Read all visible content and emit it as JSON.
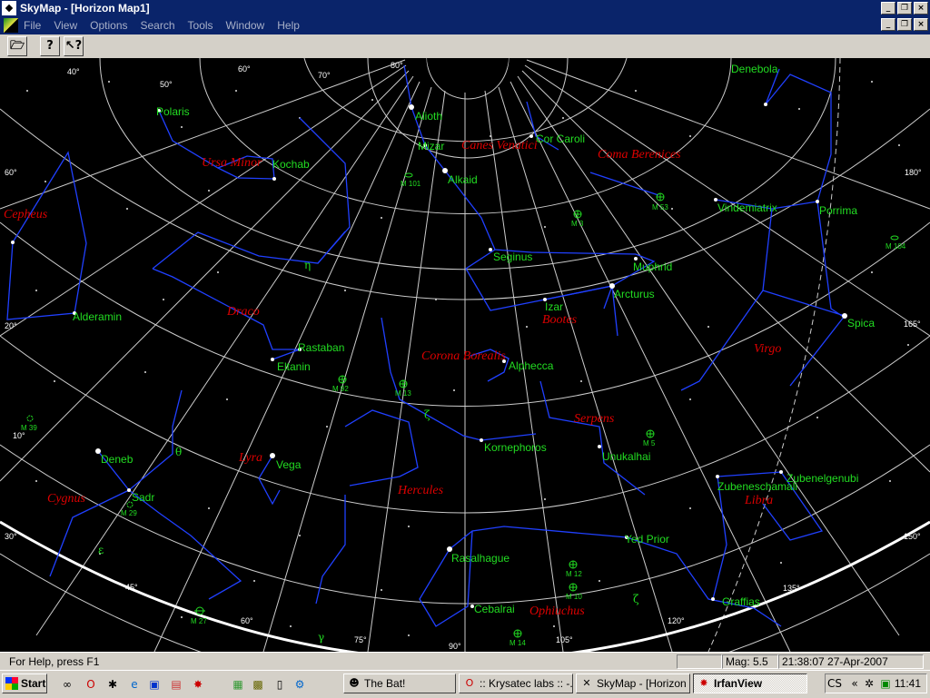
{
  "window": {
    "title": "SkyMap - [Horizon Map1]"
  },
  "menu": [
    "File",
    "View",
    "Options",
    "Search",
    "Tools",
    "Window",
    "Help"
  ],
  "toolbar": {
    "open_icon": "folder-open-icon",
    "help_icon": "help-icon",
    "context_help_icon": "context-help-icon"
  },
  "map": {
    "degree_labels": [
      "40°",
      "50°",
      "60°",
      "70°",
      "80°",
      "60°",
      "180°",
      "20°",
      "165°",
      "10°",
      "30°",
      "45°",
      "60°",
      "75°",
      "90°",
      "105°",
      "120°",
      "135°",
      "150°"
    ],
    "constellations": [
      "Cepheus",
      "Ursa Minor",
      "Draco",
      "Canes Venatici",
      "Coma Berenices",
      "Bootes",
      "Corona Borealis",
      "Virgo",
      "Serpens",
      "Lyra",
      "Hercules",
      "Cygnus",
      "Libra",
      "Ophiuchus"
    ],
    "stars": [
      "Polaris",
      "Kochab",
      "Alioth",
      "Mizar",
      "Alkaid",
      "Cor Caroli",
      "Denebola",
      "Vindemiatrix",
      "Porrima",
      "Seginus",
      "Muphrid",
      "Arcturus",
      "Izar",
      "Spica",
      "Alderamin",
      "Rastaban",
      "Eltanin",
      "Alphecca",
      "Kornephoros",
      "Unukalhai",
      "Deneb",
      "Vega",
      "Sadr",
      "Zubenelgenubi",
      "Zubeneschamali",
      "Yed Prior",
      "Rasalhague",
      "Cebalrai",
      "Graffias"
    ],
    "greek": [
      "η",
      "ζ",
      "θ",
      "ε",
      "ζ",
      "γ"
    ],
    "deep_sky": [
      "M 101",
      "M 3",
      "M 53",
      "M 104",
      "M 92",
      "M 13",
      "M 5",
      "M 39",
      "M 29",
      "M 12",
      "M 10",
      "M 14",
      "M 27"
    ]
  },
  "status": {
    "help": "For Help, press F1",
    "mag": "Mag: 5.5",
    "datetime": "21:38:07 27-Apr-2007"
  },
  "taskbar": {
    "start": "Start",
    "tasks": [
      "The Bat!",
      ":: Krysatec labs :: -...",
      "SkyMap - [Horizon ...",
      "IrfanView"
    ],
    "clock": "11:41"
  },
  "colors": {
    "title_bg": "#0a246a",
    "star_label": "#22dd22",
    "constellation_label": "#dd0000",
    "lines": "#2040ff",
    "grid": "#cccccc"
  }
}
